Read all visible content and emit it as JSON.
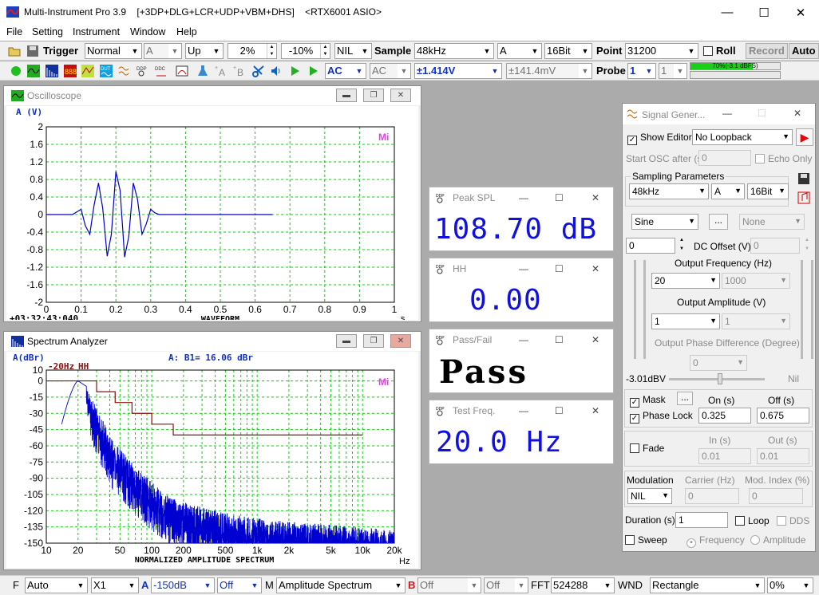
{
  "app": {
    "title": "Multi-Instrument Pro 3.9    [+3DP+DLG+LCR+UDP+VBM+DHS]    <RTX6001 ASIO>",
    "minimize": "—",
    "maximize": "☐",
    "close": "✕"
  },
  "menu": [
    "File",
    "Setting",
    "Instrument",
    "Window",
    "Help"
  ],
  "toolbar1": {
    "trigger_label": "Trigger",
    "trigger_mode": "Normal",
    "trigger_channel": "A",
    "trigger_edge": "Up",
    "trigger_level": "2%",
    "pretrigger": "-10%",
    "nil": "NIL",
    "sample_label": "Sample",
    "sample_rate": "48kHz",
    "channel": "A",
    "bits": "16Bit",
    "point_label": "Point",
    "points": "31200",
    "roll_label": "Roll",
    "record_label": "Record",
    "auto_label": "Auto"
  },
  "toolbar2": {
    "coupling_a": "AC",
    "coupling_b": "AC",
    "range_a": "±1.414V",
    "range_b": "±141.4mV",
    "probe_label": "Probe",
    "probe_a": "1",
    "probe_b": "1",
    "level_text": "70%(-3.1 dBFS)",
    "level_fraction": 0.7
  },
  "oscilloscope": {
    "title": "Oscilloscope",
    "ylabel": "A (V)",
    "xlabel": "WAVEFORM",
    "xunit": "s",
    "timestamp": "+03:32:43:040",
    "logo": "Mi",
    "chart_data": {
      "type": "line",
      "title": "",
      "xlabel": "WAVEFORM",
      "ylabel": "A (V)",
      "xlim": [
        0,
        1
      ],
      "ylim": [
        -2,
        2
      ],
      "xticks": [
        "0",
        "0.1",
        "0.2",
        "0.3",
        "0.4",
        "0.5",
        "0.6",
        "0.7",
        "0.8",
        "0.9",
        "1"
      ],
      "yticks": [
        "2",
        "1.6",
        "1.2",
        "0.8",
        "0.4",
        "0",
        "-0.4",
        "-0.8",
        "-1.2",
        "-1.6",
        "-2"
      ],
      "series": [
        {
          "signal": "20 Hz tone burst, Hann window, peak ≈ 1.0 V, burst 0.075–0.325 s, flat 0 to 0.65 s",
          "x": [
            0,
            0.075,
            0.1,
            0.112,
            0.125,
            0.137,
            0.15,
            0.162,
            0.175,
            0.187,
            0.2,
            0.212,
            0.225,
            0.237,
            0.25,
            0.262,
            0.275,
            0.287,
            0.3,
            0.312,
            0.325,
            0.65
          ],
          "y": [
            0,
            0,
            0.12,
            -0.25,
            -0.45,
            0.2,
            0.72,
            0.15,
            -0.95,
            -0.45,
            0.98,
            0.55,
            -0.97,
            -0.5,
            0.72,
            0.35,
            -0.45,
            -0.22,
            0.12,
            0.04,
            0,
            0
          ]
        }
      ]
    }
  },
  "spectrum": {
    "title": "Spectrum Analyzer",
    "ylabel": "A(dBr)",
    "header": "A:   B1=  16.06 dBr",
    "marker_left": "-20Hz",
    "marker_right": "HH",
    "xlabel": "NORMALIZED AMPLITUDE SPECTRUM",
    "xunit": "Hz",
    "logo": "Mi",
    "chart_data": {
      "type": "line",
      "title": "",
      "xlabel": "NORMALIZED AMPLITUDE SPECTRUM",
      "ylabel": "A(dBr)",
      "xscale": "log",
      "xlim": [
        10,
        20000
      ],
      "ylim": [
        -150,
        10
      ],
      "xticks": [
        10,
        20,
        50,
        100,
        200,
        500,
        1000,
        2000,
        5000,
        10000,
        20000
      ],
      "xticklabels": [
        "10",
        "20",
        "50",
        "100",
        "200",
        "500",
        "1k",
        "2k",
        "5k",
        "10k",
        "20k"
      ],
      "yticks": [
        "10",
        "0",
        "-15",
        "-30",
        "-45",
        "-60",
        "-75",
        "-90",
        "-105",
        "-120",
        "-135",
        "-150"
      ],
      "series": [
        {
          "x": [
            20,
            24,
            30,
            36,
            42,
            52,
            64,
            80,
            110,
            150,
            250,
            500,
            1000,
            2000,
            5000,
            10000,
            20000
          ],
          "y": [
            0,
            -5,
            -25,
            -40,
            -55,
            -65,
            -75,
            -85,
            -97,
            -108,
            -115,
            -122,
            -127,
            -130,
            -133,
            -135,
            -138
          ]
        },
        {
          "x": [
            10,
            30,
            30,
            45,
            45,
            65,
            65,
            100,
            100,
            160,
            160,
            10000
          ],
          "y": [
            0,
            0,
            -10,
            -10,
            -20,
            -20,
            -30,
            -30,
            -40,
            -40,
            -50,
            -50
          ]
        }
      ]
    }
  },
  "meters": [
    {
      "title": "Peak SPL",
      "value": "108.70 dB"
    },
    {
      "title": "HH",
      "value": "0.00"
    },
    {
      "title": "Pass/Fail",
      "value": "Pass"
    },
    {
      "title": "Test Freq.",
      "value": "20.0 Hz"
    }
  ],
  "siggen": {
    "title": "Signal Gener...",
    "show_editor": "Show Editor",
    "loopback": "No Loopback",
    "start_osc": "Start OSC after (s)",
    "start_osc_value": "0",
    "echo_only": "Echo Only",
    "sampling_params": "Sampling Parameters",
    "rate": "48kHz",
    "channel": "A",
    "bits": "16Bit",
    "waveform": "Sine",
    "waveform2": "None",
    "dc_offset_label": "DC Offset (V)",
    "dc_a": "0",
    "dc_b": "0",
    "freq_label": "Output Frequency (Hz)",
    "freq_a": "20",
    "freq_b": "1000",
    "amp_label": "Output Amplitude (V)",
    "amp_a": "1",
    "amp_b": "1",
    "phase_label": "Output Phase Difference (Degree)",
    "phase": "0",
    "level_left": "-3.01dBV",
    "level_right": "Nil",
    "mask_label": "Mask",
    "on_label": "On (s)",
    "off_label": "Off (s)",
    "phase_lock": "Phase Lock",
    "on_value": "0.325",
    "off_value": "0.675",
    "fade_label": "Fade",
    "in_label": "In (s)",
    "out_label": "Out (s)",
    "fade_in": "0.01",
    "fade_out": "0.01",
    "modulation_label": "Modulation",
    "carrier_label": "Carrier (Hz)",
    "mod_index_label": "Mod. Index (%)",
    "modulation": "NIL",
    "carrier": "0",
    "mod_index": "0",
    "duration_label": "Duration (s)",
    "duration": "1",
    "loop_label": "Loop",
    "dds_label": "DDS",
    "sweep_label": "Sweep",
    "sweep_freq": "Frequency",
    "sweep_amp": "Amplitude"
  },
  "statusbar": {
    "f_label": "F",
    "f_value": "Auto",
    "x_value": "X1",
    "a_label": "A",
    "a_value": "-150dB",
    "off1": "Off",
    "m_label": "M",
    "m_value": "Amplitude Spectrum",
    "b_label": "B",
    "b_off": "Off",
    "off2": "Off",
    "fft_label": "FFT",
    "fft_value": "524288",
    "wnd_label": "WND",
    "wnd_value": "Rectangle",
    "overlap": "0%"
  }
}
